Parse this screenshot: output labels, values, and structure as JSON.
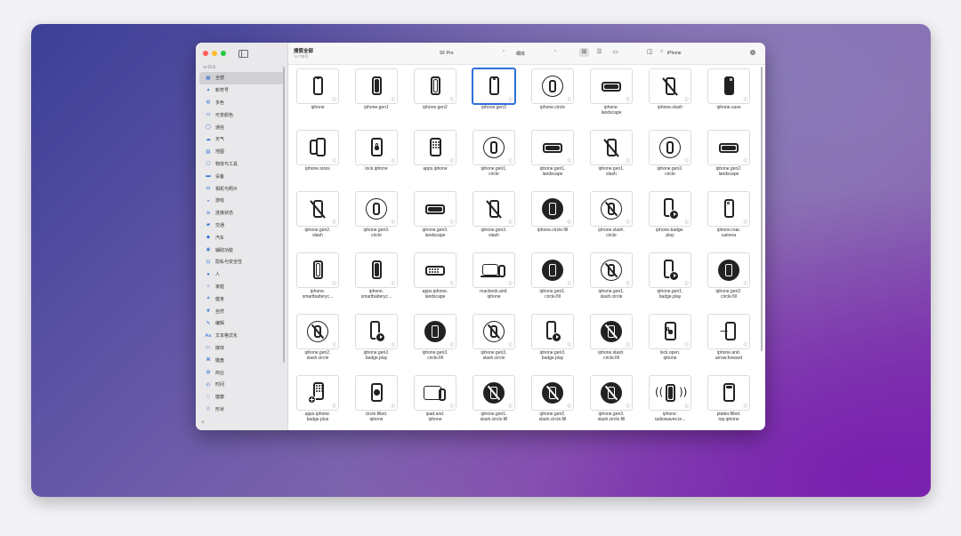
{
  "colors": {
    "accent": "#2e6fd8",
    "close": "#ff5f57",
    "minimize": "#febc2e",
    "zoom": "#28c840"
  },
  "sidebar": {
    "section_title": "SF符号",
    "items": [
      {
        "icon": "square-grid-icon",
        "glyph": "▦",
        "label": "全部"
      },
      {
        "icon": "sparkle-icon",
        "glyph": "✦",
        "label": "新符号"
      },
      {
        "icon": "paintpalette-icon",
        "glyph": "◍",
        "label": "多色"
      },
      {
        "icon": "slider-icon",
        "glyph": "▭",
        "label": "可变颜色"
      },
      {
        "icon": "message-icon",
        "glyph": "◯",
        "label": "通信"
      },
      {
        "icon": "cloud-icon",
        "glyph": "☁",
        "label": "天气"
      },
      {
        "icon": "map-icon",
        "glyph": "▨",
        "label": "地图"
      },
      {
        "icon": "folder-icon",
        "glyph": "▢",
        "label": "物体与工具"
      },
      {
        "icon": "display-icon",
        "glyph": "▬",
        "label": "设备"
      },
      {
        "icon": "camera-icon",
        "glyph": "◘",
        "label": "相机与照片"
      },
      {
        "icon": "gamecontroller-icon",
        "glyph": "◒",
        "label": "游戏"
      },
      {
        "icon": "connectivity-icon",
        "glyph": "≋",
        "label": "连接状态"
      },
      {
        "icon": "car-icon",
        "glyph": "▰",
        "label": "交通"
      },
      {
        "icon": "car-front-icon",
        "glyph": "◆",
        "label": "汽车"
      },
      {
        "icon": "accessibility-icon",
        "glyph": "◉",
        "label": "辅助功能"
      },
      {
        "icon": "lock-icon",
        "glyph": "⊡",
        "label": "隐私与安全性"
      },
      {
        "icon": "person-icon",
        "glyph": "●",
        "label": "人"
      },
      {
        "icon": "house-icon",
        "glyph": "⌂",
        "label": "家庭"
      },
      {
        "icon": "figure-run-icon",
        "glyph": "✶",
        "label": "健身"
      },
      {
        "icon": "leaf-icon",
        "glyph": "❦",
        "label": "自然"
      },
      {
        "icon": "edit-icon",
        "glyph": "✎",
        "label": "编辑"
      },
      {
        "icon": "textformat-icon",
        "glyph": "Aa",
        "label": "文本格式化"
      },
      {
        "icon": "media-icon",
        "glyph": "▷",
        "label": "媒体"
      },
      {
        "icon": "keyboard-icon",
        "glyph": "⌘",
        "label": "键盘"
      },
      {
        "icon": "cart-icon",
        "glyph": "⊞",
        "label": "商业"
      },
      {
        "icon": "clock-icon",
        "glyph": "◴",
        "label": "时间"
      },
      {
        "icon": "heart-icon",
        "glyph": "♡",
        "label": "健康"
      },
      {
        "icon": "shapes-icon",
        "glyph": "◇",
        "label": "形状"
      }
    ],
    "add_label": "+"
  },
  "toolbar": {
    "title": "搜索全部",
    "subtitle": "70个符号",
    "font": "SF Pro",
    "font_arrows": "⌃",
    "weight": "细体",
    "weight_arrows": "⌃",
    "search_value": "iPhone",
    "search_placeholder": "搜索"
  },
  "symbols": [
    {
      "g": "phone",
      "label": "iphone"
    },
    {
      "g": "phone-fill-notch",
      "label": "iphone.gen1"
    },
    {
      "g": "phone-pill",
      "label": "iphone.gen2"
    },
    {
      "g": "phone-notch",
      "label": "iphone.gen3",
      "selected": true
    },
    {
      "g": "circle-phone",
      "label": "iphone.circle"
    },
    {
      "g": "landscape",
      "label": "iphone.\nlandscape"
    },
    {
      "g": "phone-slash",
      "label": "iphone.slash"
    },
    {
      "g": "phone-filled",
      "label": "iphone.case"
    },
    {
      "g": "sizes",
      "label": "iphone.sizes"
    },
    {
      "g": "lock",
      "label": "lock.iphone"
    },
    {
      "g": "apps",
      "label": "apps.iphone"
    },
    {
      "g": "circle-phone",
      "label": "iphone.gen1.\ncircle"
    },
    {
      "g": "landscape",
      "label": "iphone.gen1.\nlandscape"
    },
    {
      "g": "phone-slash",
      "label": "iphone.gen1.\nslash"
    },
    {
      "g": "circle-phone",
      "label": "iphone.gen2.\ncircle"
    },
    {
      "g": "landscape",
      "label": "iphone.gen2.\nlandscape"
    },
    {
      "g": "phone-slash",
      "label": "iphone.gen2.\nslash"
    },
    {
      "g": "circle-phone",
      "label": "iphone.gen3.\ncircle"
    },
    {
      "g": "landscape",
      "label": "iphone.gen3.\nlandscape"
    },
    {
      "g": "phone-slash",
      "label": "iphone.gen3.\nslash"
    },
    {
      "g": "circle-fill",
      "label": "iphone.circle.fill"
    },
    {
      "g": "circle-slash",
      "label": "iphone.slash.\ncircle"
    },
    {
      "g": "badge-play",
      "label": "iphone.badge.\nplay"
    },
    {
      "g": "phone-camera",
      "label": "iphone.rear.\ncamera"
    },
    {
      "g": "phone-pill",
      "label": "iphone.\nsmartbatteryc..."
    },
    {
      "g": "phone-fill-notch",
      "label": "iphone.\nsmartbatteryc..."
    },
    {
      "g": "apps-landscape",
      "label": "apps.iphone.\nlandscape"
    },
    {
      "g": "macbook",
      "label": "macbook.and.\niphone"
    },
    {
      "g": "circle-fill",
      "label": "iphone.gen1.\ncircle.fill"
    },
    {
      "g": "circle-slash",
      "label": "iphone.gen1.\nslash.circle"
    },
    {
      "g": "badge-play",
      "label": "iphone.gen1.\nbadge.play"
    },
    {
      "g": "circle-fill",
      "label": "iphone.gen2.\ncircle.fill"
    },
    {
      "g": "circle-slash",
      "label": "iphone.gen2.\nslash.circle"
    },
    {
      "g": "badge-play",
      "label": "iphone.gen2.\nbadge.play"
    },
    {
      "g": "circle-fill",
      "label": "iphone.gen3.\ncircle.fill"
    },
    {
      "g": "circle-slash",
      "label": "iphone.gen3.\nslash.circle"
    },
    {
      "g": "badge-play",
      "label": "iphone.gen3.\nbadge.play"
    },
    {
      "g": "circle-slash-fill",
      "label": "iphone.slash.\ncircle.fill"
    },
    {
      "g": "lock-open",
      "label": "lock.open.\niphone"
    },
    {
      "g": "arrow-forward",
      "label": "iphone.and.\narrow.forward"
    },
    {
      "g": "apps-plus",
      "label": "apps.iphone.\nbadge.plus"
    },
    {
      "g": "circle-filled",
      "label": "circle.filled.\niphone"
    },
    {
      "g": "ipad",
      "label": "ipad.and.\niphone"
    },
    {
      "g": "circle-slash-fill",
      "label": "iphone.gen1.\nslash.circle.fill"
    },
    {
      "g": "circle-slash-fill",
      "label": "iphone.gen2.\nslash.circle.fill"
    },
    {
      "g": "circle-slash-fill",
      "label": "iphone.gen3.\nslash.circle.fill"
    },
    {
      "g": "radiowaves",
      "label": "iphone.\nradiowaves.le..."
    },
    {
      "g": "platter",
      "label": "platter.filled.\ntop.iphone"
    }
  ]
}
